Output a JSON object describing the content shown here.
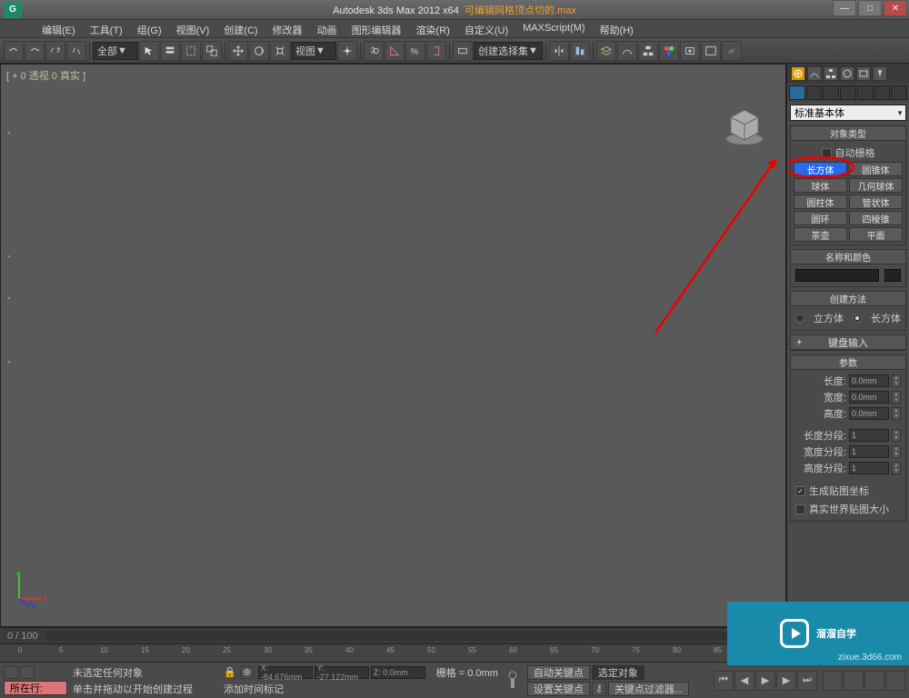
{
  "title": {
    "app": "Autodesk 3ds Max 2012 x64",
    "file": "可编辑网格顶点切的.max"
  },
  "menu": [
    "编辑(E)",
    "工具(T)",
    "组(G)",
    "视图(V)",
    "创建(C)",
    "修改器",
    "动画",
    "图形编辑器",
    "渲染(R)",
    "自定义(U)",
    "MAXScript(M)",
    "帮助(H)"
  ],
  "viewport_label": "[ + 0 透视 0 真实 ]",
  "toolbar_dropdowns": {
    "all": "全部",
    "view": "视图",
    "create": "创建选择集"
  },
  "cmd": {
    "primitive_dropdown": "标准基本体",
    "rollouts": {
      "objtype": "对象类型",
      "autogrid": "自动栅格",
      "name_color": "名称和颜色",
      "create_method": "创建方法",
      "keyboard": "键盘输入",
      "params": "参数"
    },
    "primitives": [
      [
        "长方体",
        "圆锥体"
      ],
      [
        "球体",
        "几何球体"
      ],
      [
        "圆柱体",
        "管状体"
      ],
      [
        "圆环",
        "四棱锥"
      ],
      [
        "茶壶",
        "平面"
      ]
    ],
    "radio": {
      "cube": "立方体",
      "box": "长方体"
    },
    "params": {
      "length": "长度:",
      "width": "宽度:",
      "height": "高度:",
      "lseg": "长度分段:",
      "wseg": "宽度分段:",
      "hseg": "高度分段:",
      "val_dim": "0.0mm",
      "val_seg": "1",
      "genmap": "生成贴图坐标",
      "realworld": "真实世界贴图大小"
    }
  },
  "timeline": {
    "range": "0 / 100"
  },
  "status": {
    "layers": "所在行:",
    "none_selected": "未选定任何对象",
    "click_drag": "单击并拖动以开始创建过程",
    "add_time": "添加时间标记",
    "x": "X: -84.676mm",
    "y": "Y: -27.122mm",
    "z": "Z: 0.0mm",
    "grid": "栅格 = 0.0mm",
    "autokey": "自动关键点",
    "setkey": "设置关键点",
    "selset": "选定对象",
    "keyfilter": "关键点过滤器..."
  },
  "watermark": {
    "text": "溜溜自学",
    "url": "zixue.3d66.com"
  }
}
